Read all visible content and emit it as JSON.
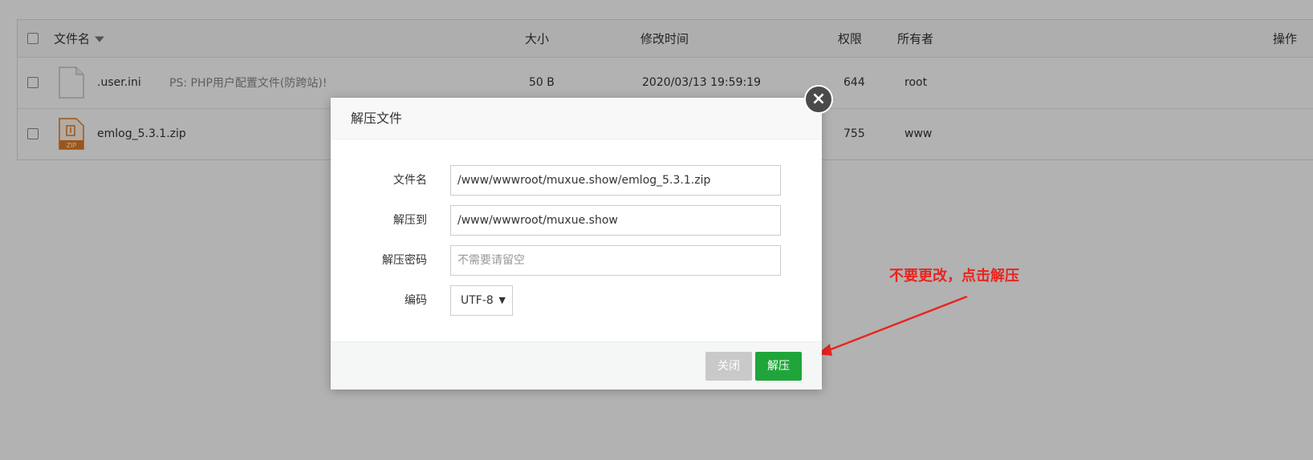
{
  "file_table": {
    "headers": {
      "name": "文件名",
      "size": "大小",
      "modified": "修改时间",
      "permissions": "权限",
      "owner": "所有者",
      "actions": "操作"
    },
    "rows": [
      {
        "name": ".user.ini",
        "note": "PS: PHP用户配置文件(防跨站)!",
        "size": "50 B",
        "modified": "2020/03/13 19:59:19",
        "permissions": "644",
        "owner": "root",
        "icon": "file-icon"
      },
      {
        "name": "emlog_5.3.1.zip",
        "zip_tag": "ZIP",
        "permissions": "755",
        "owner": "www",
        "icon": "zip-file-icon"
      }
    ]
  },
  "dialog": {
    "title": "解压文件",
    "fields": {
      "filename": {
        "label": "文件名",
        "value": "/www/wwwroot/muxue.show/emlog_5.3.1.zip"
      },
      "extract_to": {
        "label": "解压到",
        "value": "/www/wwwroot/muxue.show"
      },
      "password": {
        "label": "解压密码",
        "placeholder": "不需要请留空"
      },
      "encoding": {
        "label": "编码",
        "value": "UTF-8"
      }
    },
    "buttons": {
      "close": "关闭",
      "extract": "解压"
    }
  },
  "annotation": {
    "text": "不要更改，点击解压",
    "color": "#e8251f"
  },
  "colors": {
    "primary_green": "#20a53a",
    "overlay": "rgba(0,0,0,0.30)"
  }
}
